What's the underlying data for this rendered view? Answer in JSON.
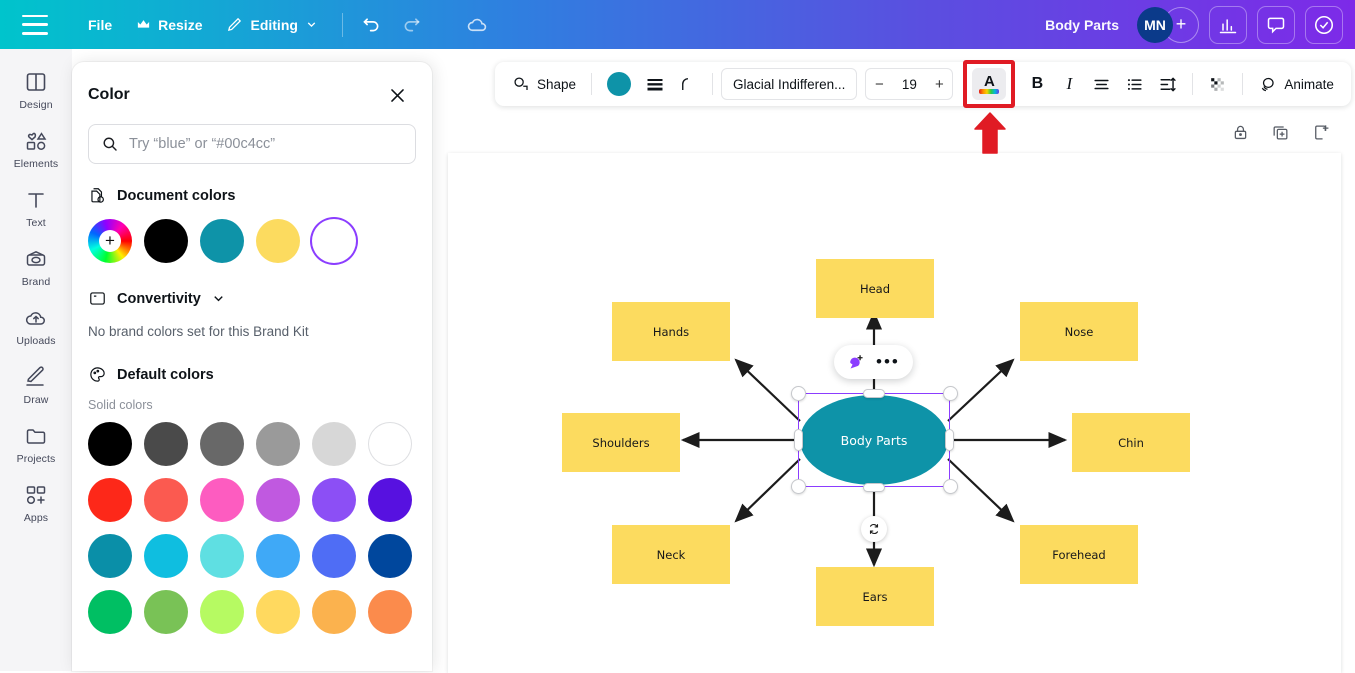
{
  "topbar": {
    "menu_icon": "hamburger-icon",
    "file_label": "File",
    "resize_label": "Resize",
    "resize_icon": "crown-icon",
    "editing_label": "Editing",
    "editing_icon": "pencil-icon",
    "editing_chevron": "chevron-down-icon",
    "undo_icon": "undo-icon",
    "redo_icon": "redo-icon",
    "cloud_icon": "cloud-sync-icon",
    "doc_title": "Body Parts",
    "avatar_initials": "MN",
    "add_collaborator": "+",
    "insights_icon": "bar-chart-icon",
    "comment_icon": "comment-bubble-icon",
    "approve_icon": "check-circle-icon",
    "gradient_from": "#00c4cc",
    "gradient_to": "#7d2ae8"
  },
  "rail": {
    "items": [
      {
        "label": "Design",
        "icon": "design-icon"
      },
      {
        "label": "Elements",
        "icon": "elements-icon"
      },
      {
        "label": "Text",
        "icon": "text-icon"
      },
      {
        "label": "Brand",
        "icon": "brand-icon"
      },
      {
        "label": "Uploads",
        "icon": "uploads-cloud-icon"
      },
      {
        "label": "Draw",
        "icon": "draw-pen-icon"
      },
      {
        "label": "Projects",
        "icon": "projects-folder-icon"
      },
      {
        "label": "Apps",
        "icon": "apps-grid-icon"
      }
    ]
  },
  "color_panel": {
    "title": "Color",
    "close_icon": "close-icon",
    "search": {
      "icon": "search-icon",
      "placeholder": "Try “blue” or “#00c4cc”",
      "value": ""
    },
    "document_colors": {
      "icon": "document-colors-icon",
      "title": "Document colors",
      "swatches": [
        {
          "name": "color-picker-wheel",
          "color": "rainbow"
        },
        {
          "name": "swatch-black",
          "color": "#000000"
        },
        {
          "name": "swatch-teal",
          "color": "#0e93a8"
        },
        {
          "name": "swatch-yellow",
          "color": "#fcdb5f"
        },
        {
          "name": "swatch-white-selected",
          "color": "#ffffff"
        }
      ]
    },
    "brand_kit": {
      "icon": "brand-kit-icon",
      "title": "Convertivity",
      "chevron": "chevron-down-icon",
      "empty_message": "No brand colors set for this Brand Kit"
    },
    "default_colors": {
      "icon": "palette-icon",
      "title": "Default colors",
      "subsection": "Solid colors",
      "rows": [
        [
          "#000000",
          "#4a4a4a",
          "#686868",
          "#9a9a9a",
          "#d7d7d7",
          "#ffffff"
        ],
        [
          "#fd2819",
          "#fb5a50",
          "#fd5cc0",
          "#c059e0",
          "#8c4ff5",
          "#5711e0"
        ],
        [
          "#0a8fa8",
          "#0fbee0",
          "#5fdfe2",
          "#3fa9f7",
          "#4f6df5",
          "#00479d"
        ],
        [
          "#00bf63",
          "#79c256",
          "#b6fa62",
          "#ffd95f",
          "#fbb24e",
          "#fb8b4c"
        ]
      ]
    }
  },
  "editor_toolbar": {
    "shape_label": "Shape",
    "shape_icon": "shape-icon",
    "fill_color": "#0e93a8",
    "line_weight_icon": "line-weight-icon",
    "corner_icon": "corner-radius-icon",
    "font_name": "Glacial Indifferen...",
    "font_size": "19",
    "decrease_icon": "minus-icon",
    "increase_icon": "plus-icon",
    "text_color_icon": "text-color-a-icon",
    "text_color_highlighted": true,
    "highlight_color": "#e01b24",
    "bold_label": "B",
    "italic_label": "I",
    "align_icon": "align-text-icon",
    "list_icon": "bullet-list-icon",
    "spacing_icon": "line-spacing-icon",
    "transparency_icon": "transparency-icon",
    "animate_label": "Animate",
    "animate_icon": "animate-icon"
  },
  "page_tools": {
    "lock_icon": "lock-icon",
    "duplicate_icon": "duplicate-page-icon",
    "add_page_icon": "add-page-icon"
  },
  "canvas": {
    "float_bar": {
      "magic_icon": "magic-write-icon",
      "more_icon": "more-options-dots-icon"
    },
    "rotate_icon": "rotate-handle-icon",
    "center_node": {
      "label": "Body Parts",
      "color": "#0e93a8",
      "selected": true
    },
    "node_color": "#fcdb5f",
    "nodes": [
      {
        "label": "Head",
        "name": "node-head"
      },
      {
        "label": "Hands",
        "name": "node-hands"
      },
      {
        "label": "Nose",
        "name": "node-nose"
      },
      {
        "label": "Shoulders",
        "name": "node-shoulders"
      },
      {
        "label": "Chin",
        "name": "node-chin"
      },
      {
        "label": "Neck",
        "name": "node-neck"
      },
      {
        "label": "Forehead",
        "name": "node-forehead"
      },
      {
        "label": "Ears",
        "name": "node-ears"
      }
    ]
  }
}
